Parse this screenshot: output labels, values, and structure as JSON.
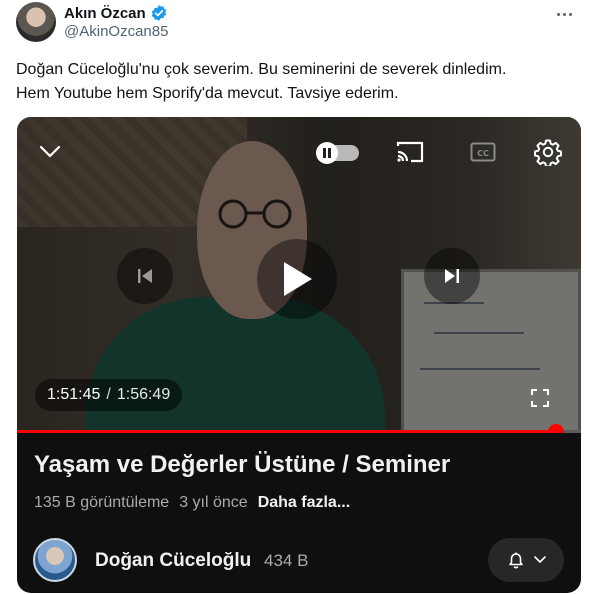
{
  "tweet": {
    "author_name": "Akın Özcan",
    "handle": "@AkinOzcan85",
    "text_lines": [
      "Doğan Cüceloğlu'nu çok severim. Bu seminerini de severek dinledim.",
      "Hem Youtube hem Sporify'da mevcut. Tavsiye ederim."
    ],
    "verified_color": "#1d9bf0"
  },
  "player": {
    "current_time": "1:51:45",
    "separator": "/",
    "duration": "1:56:49",
    "progress_fraction": 0.956,
    "accent_color": "#ff0000"
  },
  "video": {
    "title": "Yaşam ve Değerler Üstüne / Seminer",
    "views": "135 B görüntüleme",
    "age": "3 yıl önce",
    "more_label": "Daha fazla..."
  },
  "channel": {
    "name": "Doğan Cüceloğlu",
    "subscribers": "434 B"
  },
  "icons": [
    "more-icon",
    "verified-icon",
    "chevron-down-icon",
    "pause-icon",
    "cast-icon",
    "captions-icon",
    "settings-gear-icon",
    "previous-icon",
    "play-icon",
    "next-icon",
    "fullscreen-icon",
    "bell-icon"
  ]
}
